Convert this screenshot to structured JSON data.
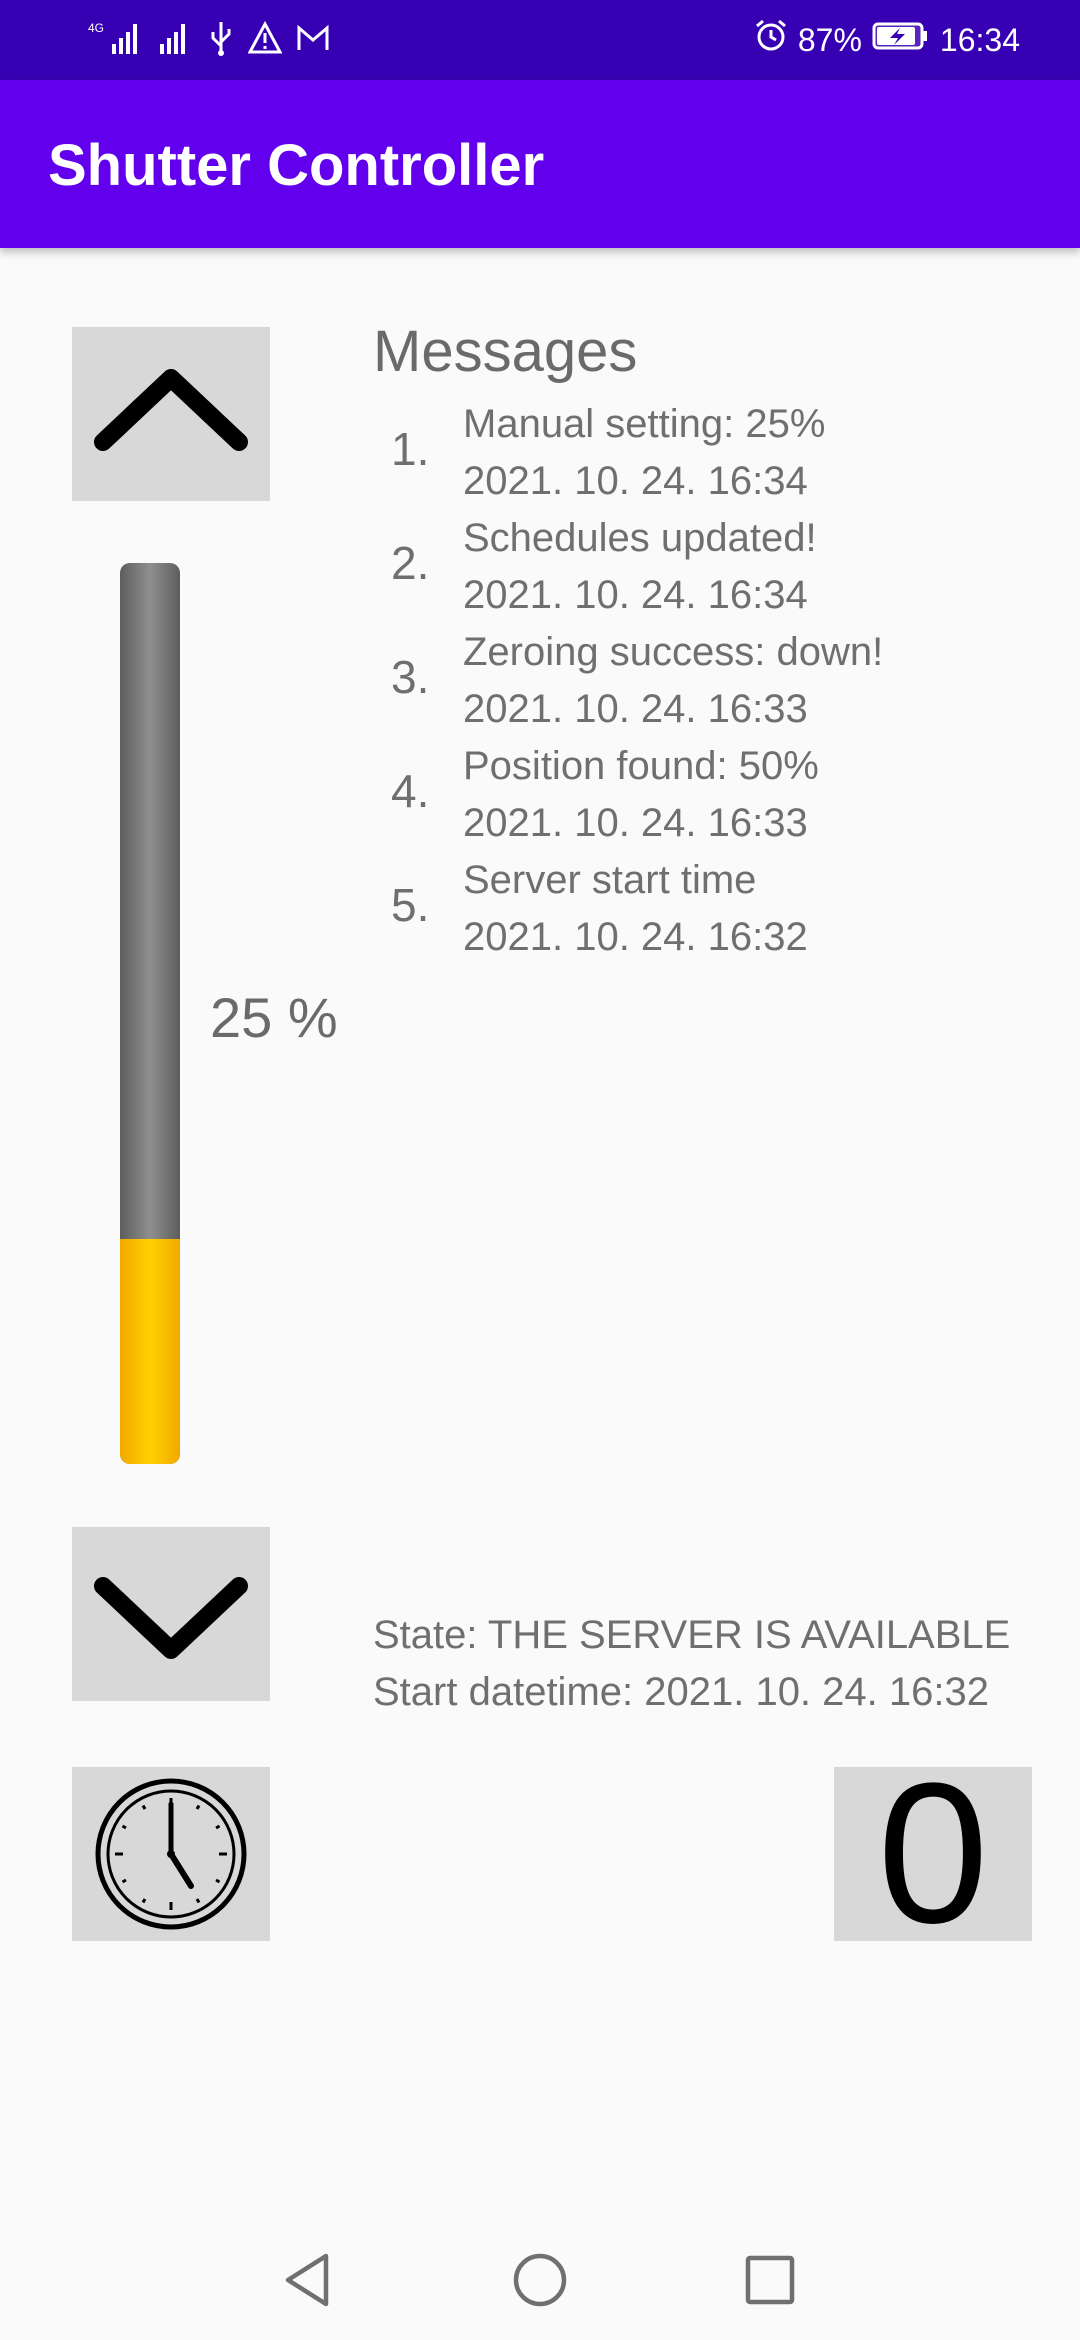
{
  "status_bar": {
    "network_label": "4G",
    "battery": "87%",
    "time": "16:34",
    "icons": [
      "signal-icon",
      "signal-icon",
      "usb-icon",
      "warning-icon",
      "mail-icon",
      "alarm-icon",
      "battery-charging-icon"
    ]
  },
  "app_bar": {
    "title": "Shutter Controller"
  },
  "colors": {
    "status_bar": "#3700b3",
    "app_bar": "#6200ee",
    "slider_fill": "#ffc000",
    "slider_track": "#707170",
    "button_bg": "#d7d8d7"
  },
  "shutter": {
    "position_percent": 25,
    "percent_label": "25 %"
  },
  "messages": {
    "title": "Messages",
    "items": [
      {
        "num": "1.",
        "text": "Manual setting: 25%",
        "time": "2021. 10. 24. 16:34"
      },
      {
        "num": "2.",
        "text": "Schedules updated!",
        "time": "2021. 10. 24. 16:34"
      },
      {
        "num": "3.",
        "text": "Zeroing success: down!",
        "time": "2021. 10. 24. 16:33"
      },
      {
        "num": "4.",
        "text": "Position found: 50%",
        "time": "2021. 10. 24. 16:33"
      },
      {
        "num": "5.",
        "text": "Server start time",
        "time": "2021. 10. 24. 16:32"
      }
    ]
  },
  "state": {
    "state_line": "State: THE SERVER IS AVAILABLE",
    "start_line": "Start datetime: 2021. 10. 24. 16:32"
  },
  "buttons": {
    "up_icon": "chevron-up-icon",
    "down_icon": "chevron-down-icon",
    "clock_icon": "clock-icon",
    "zero_label": "0"
  }
}
